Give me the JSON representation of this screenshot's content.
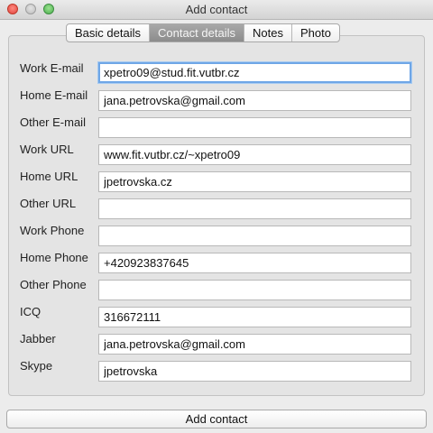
{
  "window": {
    "title": "Add contact"
  },
  "tabs": [
    {
      "label": "Basic details"
    },
    {
      "label": "Contact details"
    },
    {
      "label": "Notes"
    },
    {
      "label": "Photo"
    }
  ],
  "fields": [
    {
      "label": "Work E-mail",
      "value": "xpetro09@stud.fit.vutbr.cz"
    },
    {
      "label": "Home E-mail",
      "value": "jana.petrovska@gmail.com"
    },
    {
      "label": "Other E-mail",
      "value": ""
    },
    {
      "label": "Work URL",
      "value": "www.fit.vutbr.cz/~xpetro09"
    },
    {
      "label": "Home URL",
      "value": "jpetrovska.cz"
    },
    {
      "label": "Other URL",
      "value": ""
    },
    {
      "label": "Work Phone",
      "value": ""
    },
    {
      "label": "Home Phone",
      "value": "+420923837645"
    },
    {
      "label": "Other Phone",
      "value": ""
    },
    {
      "label": "ICQ",
      "value": "316672111"
    },
    {
      "label": "Jabber",
      "value": "jana.petrovska@gmail.com"
    },
    {
      "label": "Skype",
      "value": "jpetrovska"
    }
  ],
  "actions": {
    "add_label": "Add contact"
  }
}
